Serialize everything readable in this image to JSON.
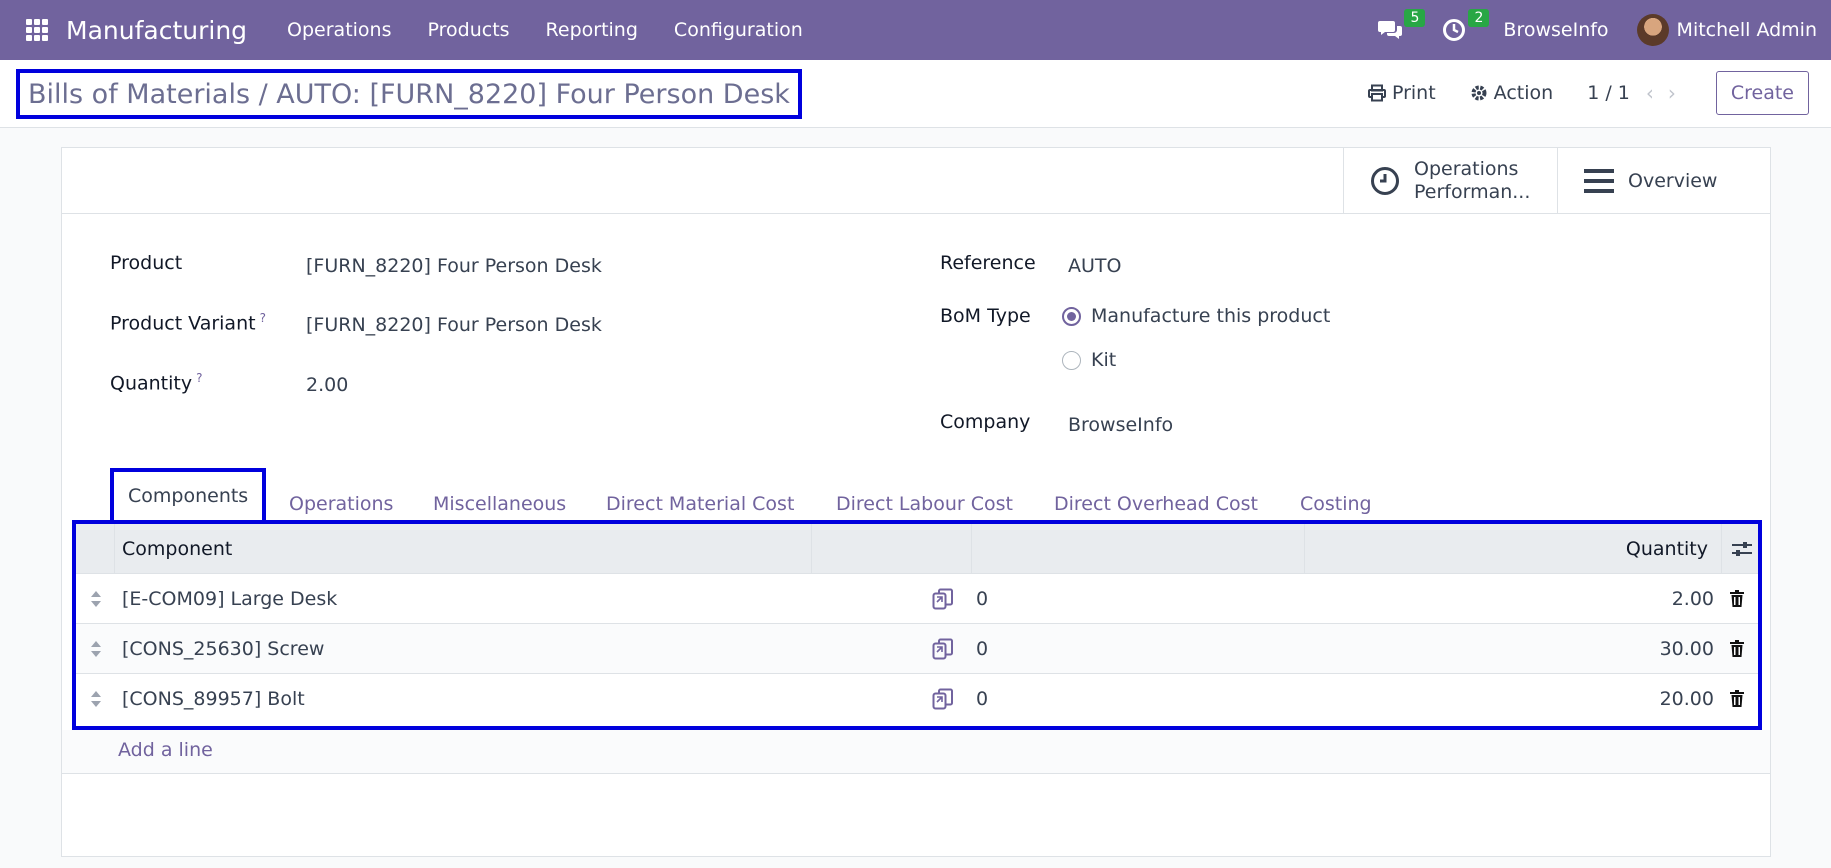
{
  "navbar": {
    "app_name": "Manufacturing",
    "menu": [
      "Operations",
      "Products",
      "Reporting",
      "Configuration"
    ],
    "messages_count": "5",
    "activities_count": "2",
    "company": "BrowseInfo",
    "user": "Mitchell Admin",
    "bg_color": "#71639e"
  },
  "control_panel": {
    "breadcrumb": "Bills of Materials / AUTO: [FURN_8220] Four Person Desk",
    "print_label": "Print",
    "action_label": "Action",
    "pager": "1 / 1",
    "create_label": "Create"
  },
  "smart_buttons": {
    "operations_performance_line1": "Operations",
    "operations_performance_line2": "Performan...",
    "overview": "Overview"
  },
  "form": {
    "product_label": "Product",
    "product_value": "[FURN_8220] Four Person Desk",
    "variant_label": "Product Variant",
    "variant_value": "[FURN_8220] Four Person Desk",
    "quantity_label": "Quantity",
    "quantity_value": "2.00",
    "help_mark": "?",
    "reference_label": "Reference",
    "reference_value": "AUTO",
    "bom_type_label": "BoM Type",
    "bom_type_options": [
      "Manufacture this product",
      "Kit"
    ],
    "bom_type_selected": "Manufacture this product",
    "company_label": "Company",
    "company_value": "BrowseInfo"
  },
  "tabs": [
    "Components",
    "Operations",
    "Miscellaneous",
    "Direct Material Cost",
    "Direct Labour Cost",
    "Direct Overhead Cost",
    "Costing"
  ],
  "active_tab": "Components",
  "table": {
    "headers": {
      "component": "Component",
      "quantity": "Quantity"
    },
    "rows": [
      {
        "component": "[E-COM09] Large Desk",
        "count": "0",
        "quantity": "2.00"
      },
      {
        "component": "[CONS_25630] Screw",
        "count": "0",
        "quantity": "30.00"
      },
      {
        "component": "[CONS_89957] Bolt",
        "count": "0",
        "quantity": "20.00"
      }
    ],
    "add_line": "Add a line"
  }
}
